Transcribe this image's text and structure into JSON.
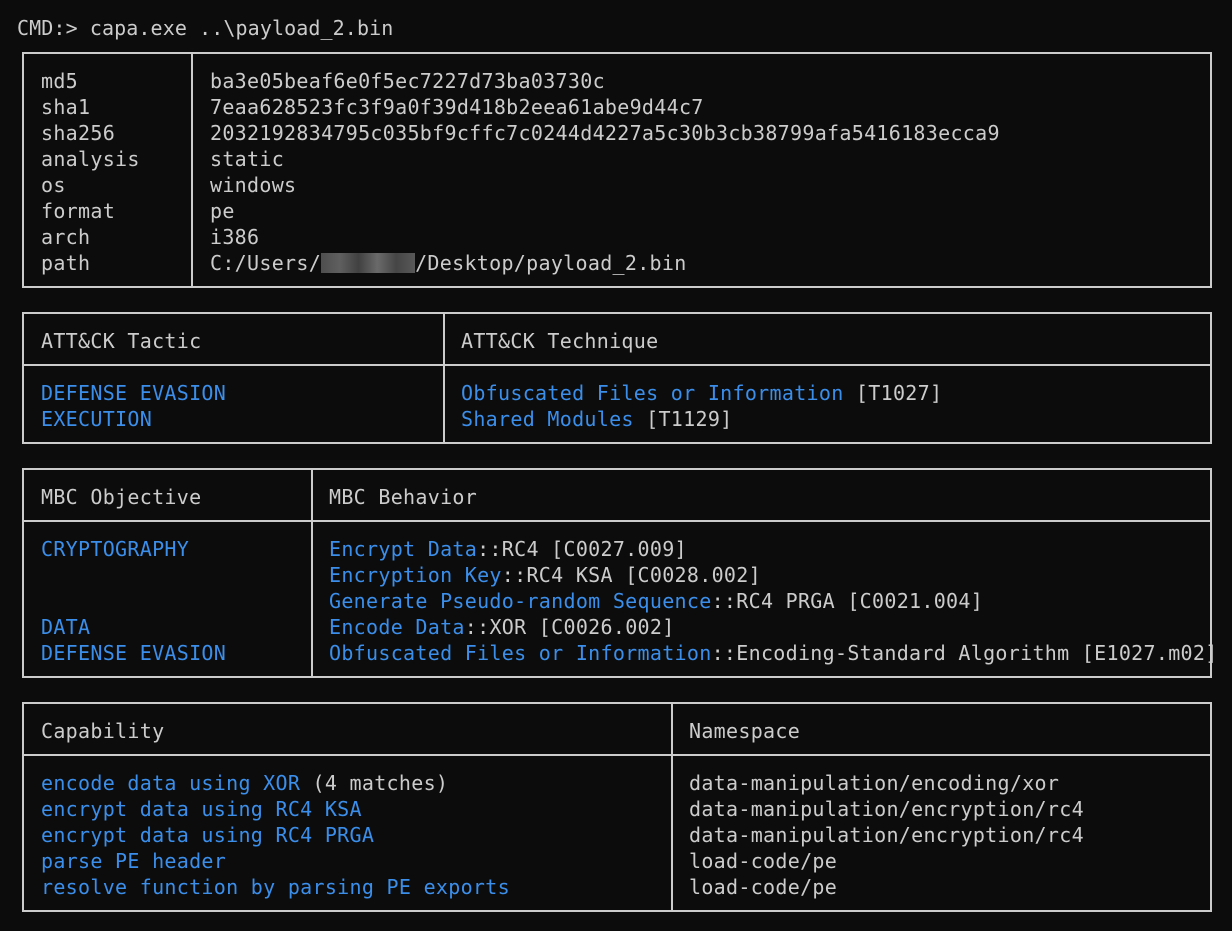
{
  "prompt": "CMD:> capa.exe ..\\payload_2.bin",
  "meta": {
    "rows": [
      {
        "key": "md5",
        "value": "ba3e05beaf6e0f5ec7227d73ba03730c"
      },
      {
        "key": "sha1",
        "value": "7eaa628523fc3f9a0f39d418b2eea61abe9d44c7"
      },
      {
        "key": "sha256",
        "value": "2032192834795c035bf9cffc7c0244d4227a5c30b3cb38799afa5416183ecca9"
      },
      {
        "key": "analysis",
        "value": "static"
      },
      {
        "key": "os",
        "value": "windows"
      },
      {
        "key": "format",
        "value": "pe"
      },
      {
        "key": "arch",
        "value": "i386"
      }
    ],
    "path_key": "path",
    "path_prefix": "C:/Users/",
    "path_suffix": "/Desktop/payload_2.bin"
  },
  "attack": {
    "headers": [
      "ATT&CK Tactic",
      "ATT&CK Technique"
    ],
    "rows": [
      {
        "tactic": "DEFENSE EVASION",
        "technique": "Obfuscated Files or Information",
        "id": " [T1027]"
      },
      {
        "tactic": "EXECUTION",
        "technique": "Shared Modules",
        "id": " [T1129]"
      }
    ]
  },
  "mbc": {
    "headers": [
      "MBC Objective",
      "MBC Behavior"
    ],
    "rows": [
      {
        "objective": "CRYPTOGRAPHY",
        "behavior": "Encrypt Data",
        "detail": "::RC4 [C0027.009]"
      },
      {
        "objective": "",
        "behavior": "Encryption Key",
        "detail": "::RC4 KSA [C0028.002]"
      },
      {
        "objective": "",
        "behavior": "Generate Pseudo-random Sequence",
        "detail": "::RC4 PRGA [C0021.004]"
      },
      {
        "objective": "DATA",
        "behavior": "Encode Data",
        "detail": "::XOR [C0026.002]"
      },
      {
        "objective": "DEFENSE EVASION",
        "behavior": "Obfuscated Files or Information",
        "detail": "::Encoding-Standard Algorithm [E1027.m02]"
      }
    ]
  },
  "capabilities": {
    "headers": [
      "Capability",
      "Namespace"
    ],
    "rows": [
      {
        "capability": "encode data using XOR",
        "extra": " (4 matches)",
        "namespace": "data-manipulation/encoding/xor"
      },
      {
        "capability": "encrypt data using RC4 KSA",
        "extra": "",
        "namespace": "data-manipulation/encryption/rc4"
      },
      {
        "capability": "encrypt data using RC4 PRGA",
        "extra": "",
        "namespace": "data-manipulation/encryption/rc4"
      },
      {
        "capability": "parse PE header",
        "extra": "",
        "namespace": "load-code/pe"
      },
      {
        "capability": "resolve function by parsing PE exports",
        "extra": "",
        "namespace": "load-code/pe"
      }
    ]
  },
  "colors": {
    "background": "#0c0c0c",
    "text": "#cccccc",
    "link": "#3b8eea"
  }
}
